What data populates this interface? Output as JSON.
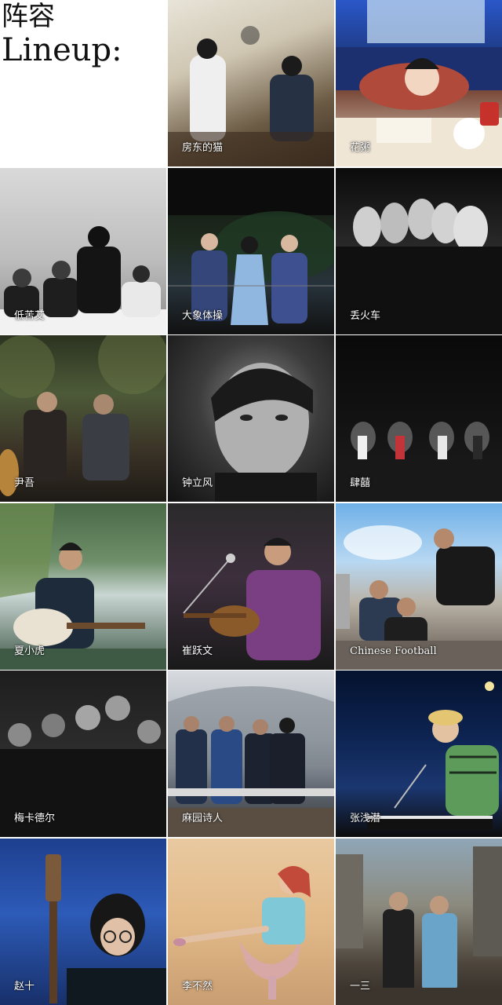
{
  "title": {
    "zh": "阵容",
    "en": "Lineup:"
  },
  "artists": [
    {
      "id": "fangdong",
      "name": "房东的猫"
    },
    {
      "id": "huajie",
      "name": "花粥"
    },
    {
      "id": "diku",
      "name": "低苦艾"
    },
    {
      "id": "daxiang",
      "name": "大象体操"
    },
    {
      "id": "diuhuoche",
      "name": "丢火车"
    },
    {
      "id": "yinwu",
      "name": "尹吾"
    },
    {
      "id": "zhongli",
      "name": "钟立风"
    },
    {
      "id": "siyi",
      "name": "肆囍"
    },
    {
      "id": "xiaxiaohu",
      "name": "夏小虎"
    },
    {
      "id": "cuiyuewen",
      "name": "崔跃文"
    },
    {
      "id": "chinesefootball",
      "name": "Chinese Football"
    },
    {
      "id": "meikadeer",
      "name": "梅卡德尔"
    },
    {
      "id": "mayuan",
      "name": "麻园诗人"
    },
    {
      "id": "zhangqianqian",
      "name": "张浅潜"
    },
    {
      "id": "zhaoshi",
      "name": "赵十"
    },
    {
      "id": "libu",
      "name": "李不然"
    },
    {
      "id": "yisan",
      "name": "一三"
    }
  ]
}
